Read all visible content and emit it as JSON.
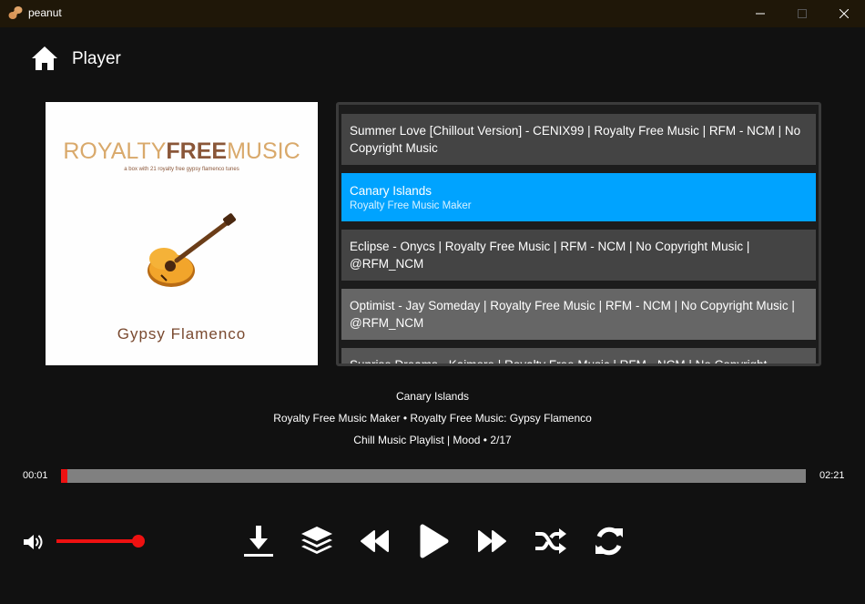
{
  "window": {
    "app_name": "peanut",
    "minimize_icon": "minimize-icon",
    "maximize_icon": "maximize-icon",
    "close_icon": "close-icon"
  },
  "header": {
    "title": "Player",
    "home_icon": "home-icon"
  },
  "album_art": {
    "brand_part1": "ROYALTY",
    "brand_part2": "FREE",
    "brand_part3": "MUSIC",
    "subtitle": "a box with 21 royalty free gypsy flamenco tunes",
    "album_name": "Gypsy Flamenco"
  },
  "playlist": {
    "items": [
      {
        "title": "Summer Love [Chillout Version] - CENIX99 | Royalty Free Music | RFM - NCM | No Copyright Music",
        "subtitle": ""
      },
      {
        "title": "Canary Islands",
        "subtitle": "Royalty Free Music Maker",
        "selected": true
      },
      {
        "title": "Eclipse - Onycs | Royalty Free Music | RFM - NCM | No Copyright Music | @RFM_NCM",
        "subtitle": ""
      },
      {
        "title": "Optimist - Jay Someday | Royalty Free Music | RFM - NCM | No Copyright Music | @RFM_NCM",
        "subtitle": ""
      },
      {
        "title": "Sunrise Dreams - Kaimore | Royalty Free Music | RFM - NCM | No Copyright",
        "subtitle": ""
      }
    ]
  },
  "now_playing": {
    "title": "Canary Islands",
    "artist_album": "Royalty Free Music Maker • Royalty Free Music: Gypsy Flamenco",
    "playlist_info": "Chill Music Playlist | Mood • 2/17"
  },
  "progress": {
    "current": "00:01",
    "total": "02:21",
    "fraction": 0.007
  },
  "volume": {
    "level": 1.0,
    "icon": "volume-icon"
  },
  "controls": [
    "download-icon",
    "layers-icon",
    "previous-icon",
    "play-icon",
    "next-icon",
    "shuffle-icon",
    "repeat-icon"
  ],
  "colors": {
    "accent": "#ee1111",
    "selected": "#00a3ff",
    "titlebar": "#1f1708",
    "background": "#111111"
  }
}
